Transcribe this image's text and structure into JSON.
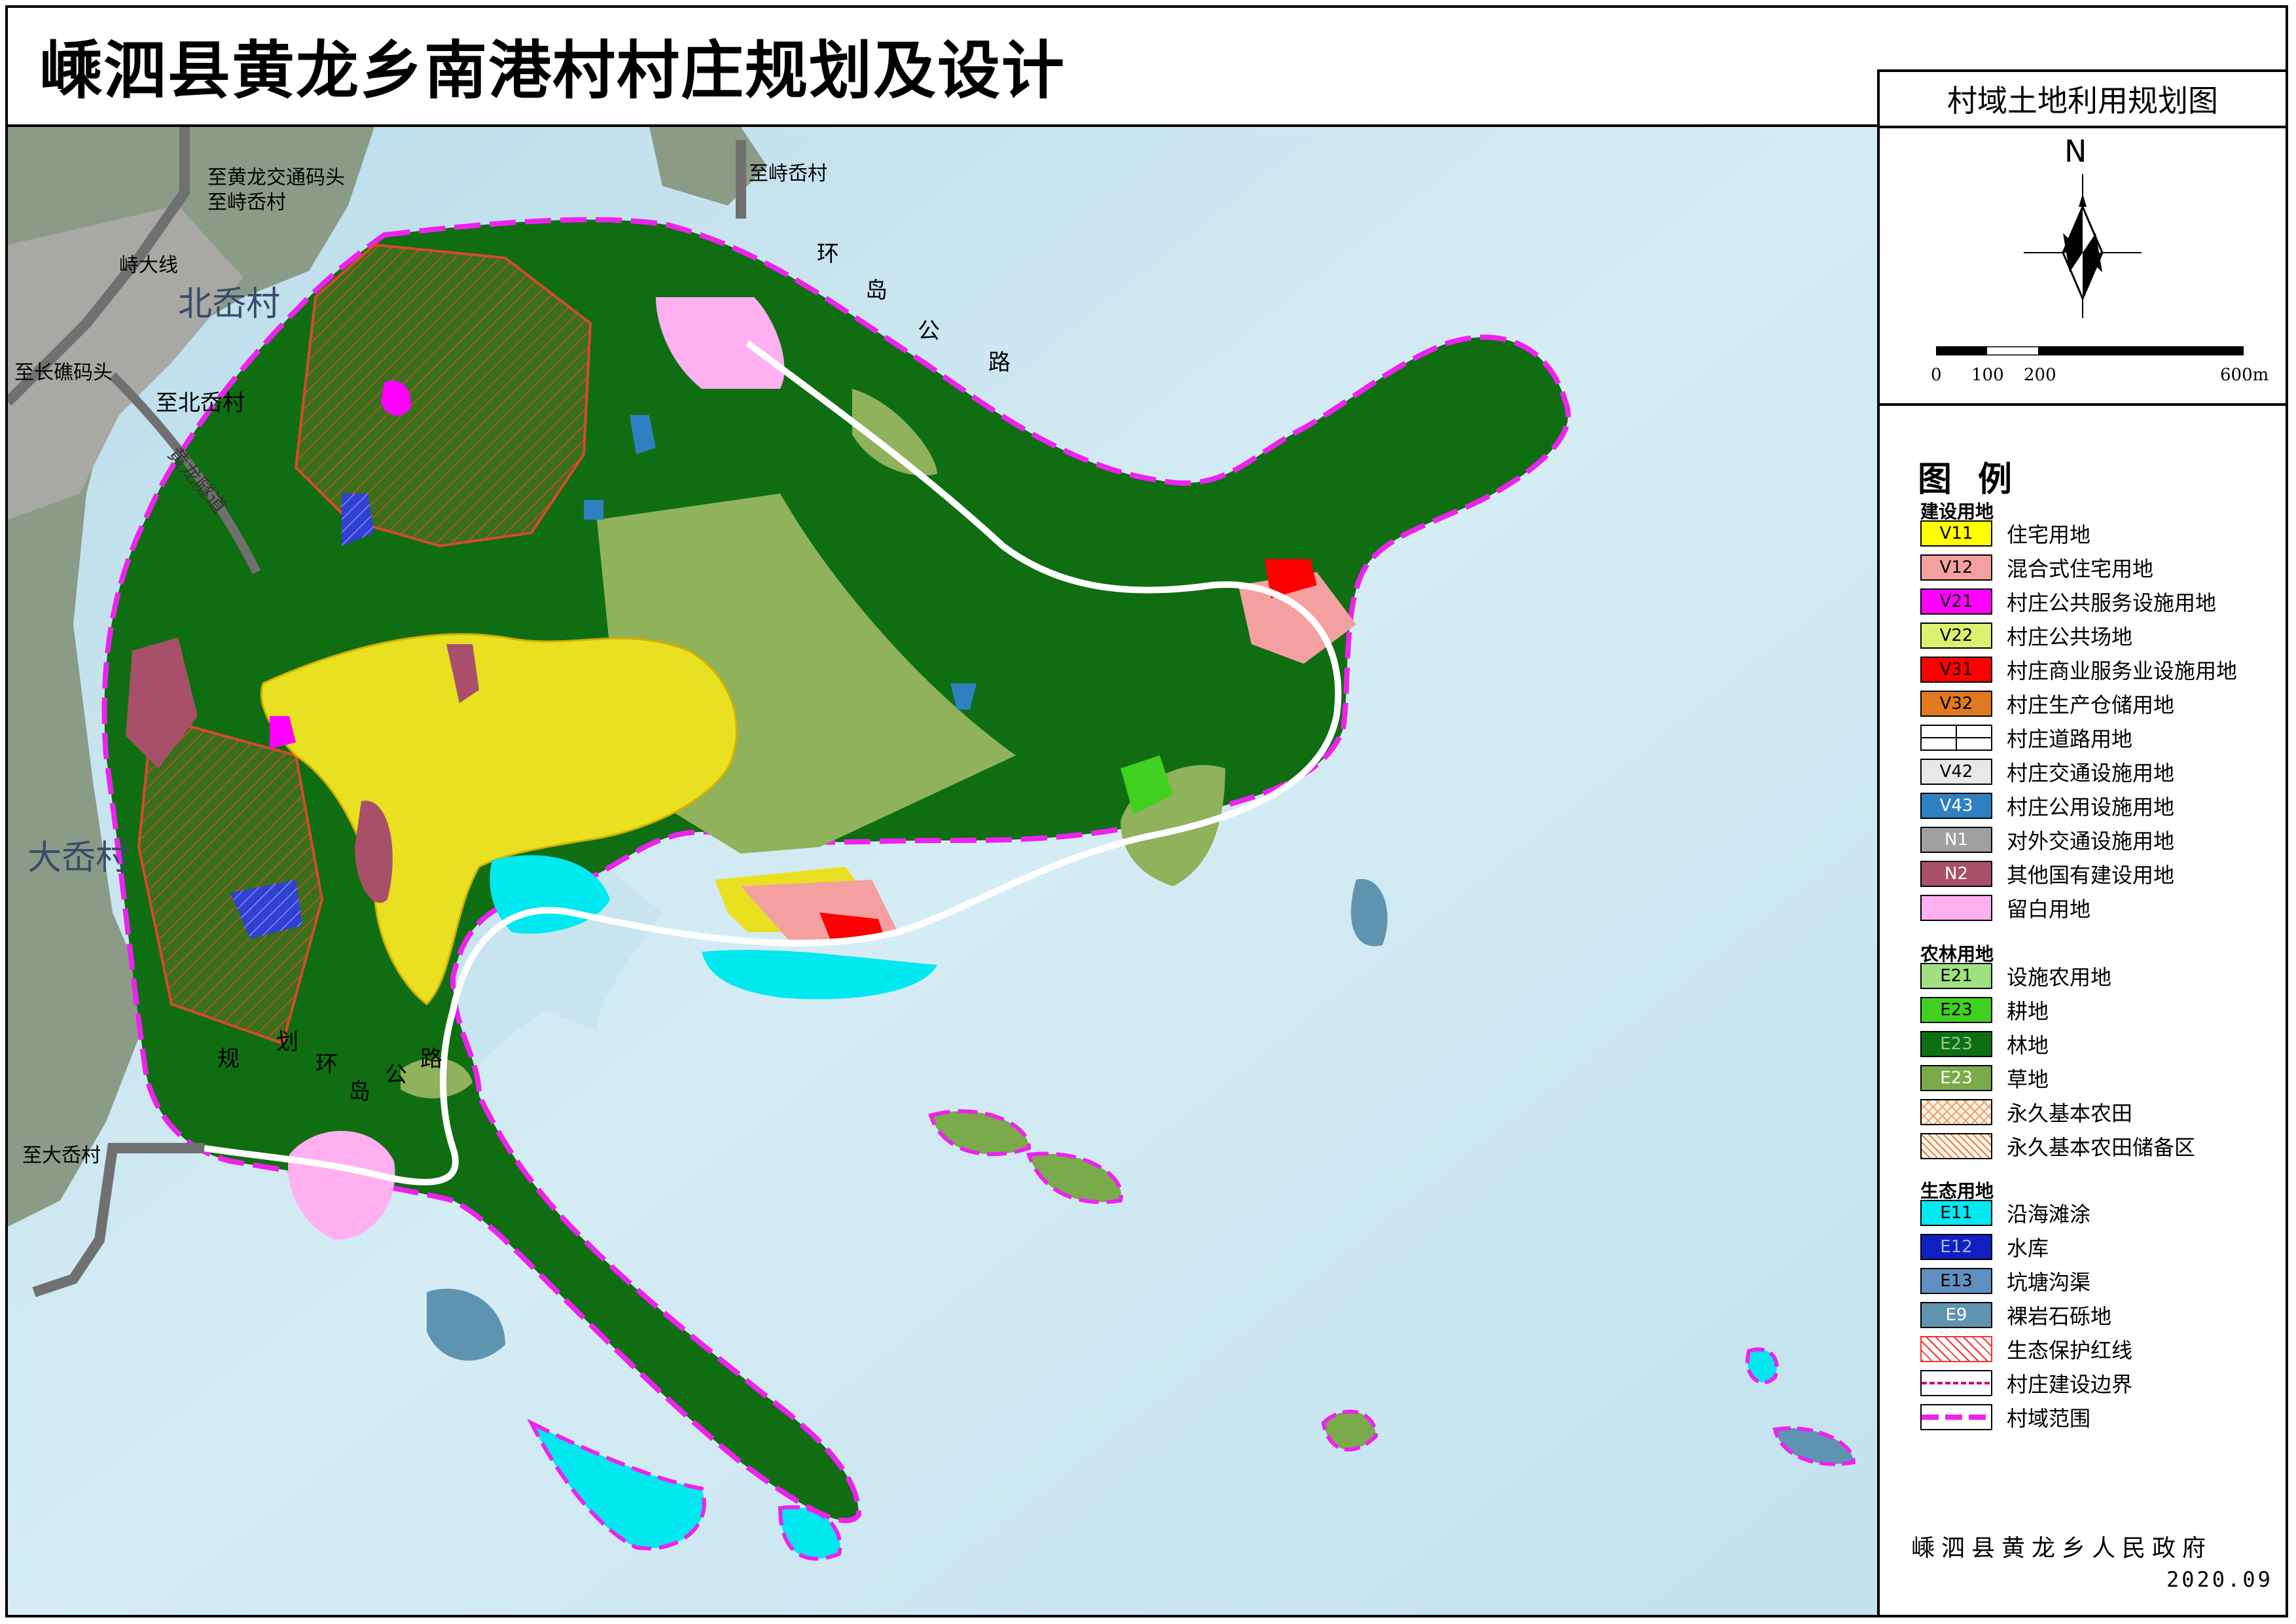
{
  "title": "嵊泗县黄龙乡南港村村庄规划及设计",
  "panel_title": "村域土地利用规划图",
  "north_label": "N",
  "scale": {
    "labels": [
      "0",
      "100",
      "200",
      "600m"
    ]
  },
  "legend": {
    "heading": "图例",
    "groups": [
      {
        "name": "建设用地",
        "items": [
          {
            "code": "V11",
            "label": "住宅用地",
            "color": "#ffff00"
          },
          {
            "code": "V12",
            "label": "混合式住宅用地",
            "color": "#f4a0a0"
          },
          {
            "code": "V21",
            "label": "村庄公共服务设施用地",
            "color": "#ff00ff"
          },
          {
            "code": "V22",
            "label": "村庄公共场地",
            "color": "#ddf070"
          },
          {
            "code": "V31",
            "label": "村庄商业服务业设施用地",
            "color": "#ff0000"
          },
          {
            "code": "V32",
            "label": "村庄生产仓储用地",
            "color": "#e07a20"
          },
          {
            "code": "",
            "label": "村庄道路用地",
            "color": "#ffffff"
          },
          {
            "code": "V42",
            "label": "村庄交通设施用地",
            "color": "#e8e8e8"
          },
          {
            "code": "V43",
            "label": "村庄公用设施用地",
            "color": "#2f80c0"
          },
          {
            "code": "N1",
            "label": "对外交通设施用地",
            "color": "#a0a0a0"
          },
          {
            "code": "N2",
            "label": "其他国有建设用地",
            "color": "#a8506a"
          },
          {
            "code": "",
            "label": "留白用地",
            "color": "#ffb0f0"
          }
        ]
      },
      {
        "name": "农林用地",
        "items": [
          {
            "code": "E21",
            "label": "设施农用地",
            "color": "#a0e080"
          },
          {
            "code": "E23",
            "label": "耕地",
            "color": "#40d020"
          },
          {
            "code": "E23",
            "label": "林地",
            "color": "#0f6e12"
          },
          {
            "code": "E23",
            "label": "草地",
            "color": "#7aaa4a"
          },
          {
            "code": "",
            "label": "永久基本农田",
            "color": "#f0a060"
          },
          {
            "code": "",
            "label": "永久基本农田储备区",
            "color": "#e08040"
          }
        ]
      },
      {
        "name": "生态用地",
        "items": [
          {
            "code": "E11",
            "label": "沿海滩涂",
            "color": "#00e8f0"
          },
          {
            "code": "E12",
            "label": "水库",
            "color": "#1020c0"
          },
          {
            "code": "E13",
            "label": "坑塘沟渠",
            "color": "#6090c0"
          },
          {
            "code": "E9",
            "label": "裸岩石砾地",
            "color": "#5f94b0"
          },
          {
            "code": "",
            "label": "生态保护红线",
            "color": "#ff3030"
          },
          {
            "code": "",
            "label": "村庄建设边界",
            "color": "#cc0077"
          },
          {
            "code": "",
            "label": "村域范围",
            "color": "#ee22ee"
          }
        ]
      }
    ]
  },
  "map_labels": {
    "to_huanglong": "至黄龙交通码头",
    "to_shibenao": "至峙岙村",
    "to_shibenao_ne": "至峙岙村",
    "shida_line": "峙大线",
    "beiao": "北岙村",
    "to_changqiao": "至长礁码头",
    "to_beiao": "至北岙村",
    "daao": "大岙村",
    "to_daao": "至大岙村",
    "tunnel_road": "黄龙隧道",
    "ring_ne": [
      "环",
      "岛",
      "公",
      "路"
    ],
    "ring_sw": [
      "规",
      "划",
      "环",
      "岛",
      "公",
      "路"
    ]
  },
  "footer": {
    "org": "嵊泗县黄龙乡人民政府",
    "date": "2020.09"
  }
}
